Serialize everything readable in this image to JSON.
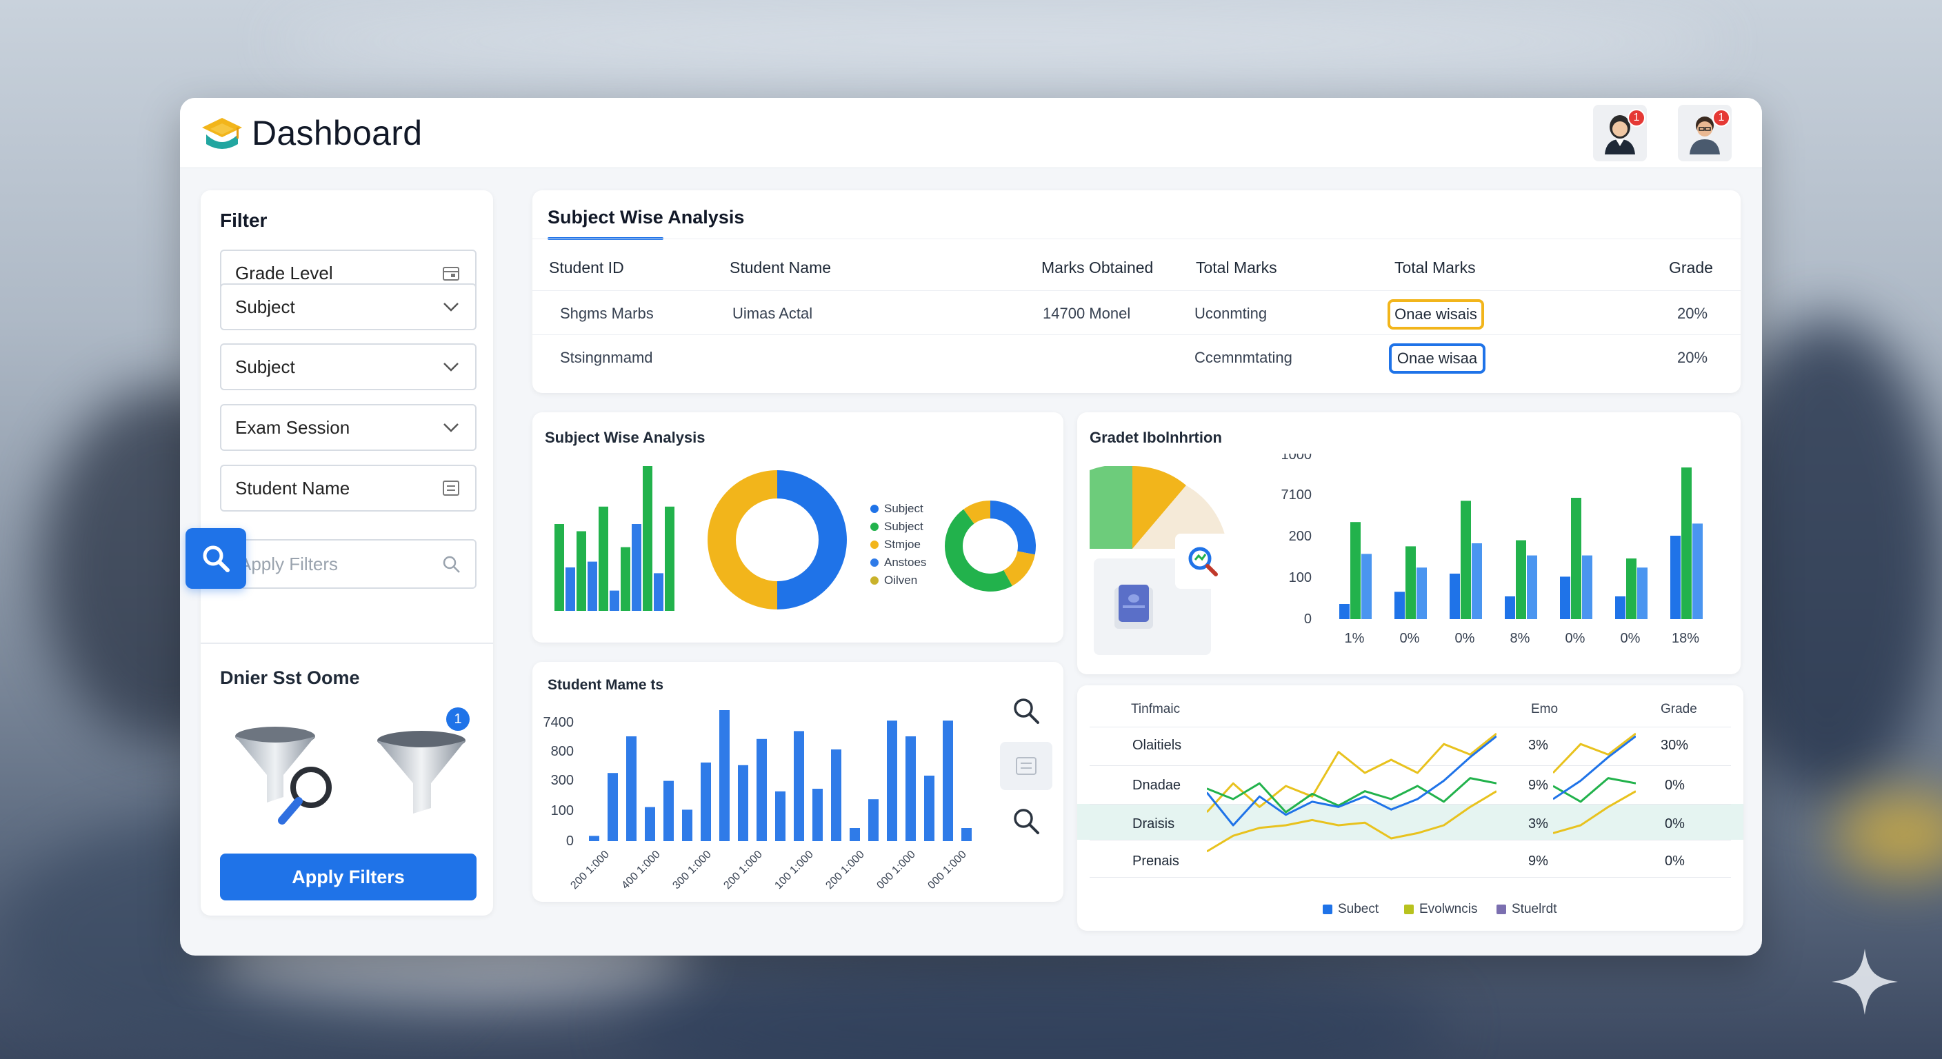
{
  "app": {
    "title": "Dashboard"
  },
  "header": {
    "avatars": [
      {
        "name": "user-avatar-1",
        "badge": "1"
      },
      {
        "name": "user-avatar-2",
        "badge": "1"
      }
    ]
  },
  "filter": {
    "title": "Filter",
    "fields": [
      {
        "label": "Grade Level",
        "icon": "calendar-icon"
      },
      {
        "label": "Subject",
        "icon": "chevron-down-icon"
      },
      {
        "label": "Subject",
        "icon": "chevron-down-icon"
      },
      {
        "label": "Exam Session",
        "icon": "chevron-down-icon"
      },
      {
        "label": "Student Name",
        "icon": "list-icon"
      }
    ],
    "search_placeholder": "Apply Filters",
    "saved_title": "Dnier Sst Oome",
    "saved_badge": "1",
    "apply_label": "Apply Filters"
  },
  "table": {
    "title": "Subject Wise Analysis",
    "headers": [
      "Student ID",
      "Student Name",
      "Marks Obtained",
      "Total Marks",
      "Total Marks",
      "Grade"
    ],
    "rows": [
      [
        "Shgms Marbs",
        "Uimas Actal",
        "14700 Monel",
        "Uconmting",
        "Onae wisais",
        "20%"
      ],
      [
        "Stsingnmamd",
        "",
        "",
        "Ccemnmtating",
        "Onae wisaa",
        "20%"
      ]
    ]
  },
  "subject_card": {
    "title": "Subject Wise Analysis",
    "legend": [
      "Subject",
      "Subject",
      "Stmjoe",
      "Anstoes",
      "Oilven"
    ]
  },
  "grade_card": {
    "title": "Gradet Ibolnhrtion"
  },
  "student_card": {
    "title": "Student Mame ts"
  },
  "trend_card": {
    "headers": [
      "Tinfmaic",
      "Emo",
      "Grade"
    ],
    "rows": [
      {
        "label": "Olaitiels",
        "mid": "3%",
        "grade": "30%"
      },
      {
        "label": "Dnadae",
        "mid": "9%",
        "grade": "0%"
      },
      {
        "label": "Draisis",
        "mid": "3%",
        "grade": "0%"
      },
      {
        "label": "Prenais",
        "mid": "9%",
        "grade": "0%"
      }
    ],
    "legend": [
      "Subect",
      "Evolwncis",
      "Stuelrdt"
    ]
  },
  "colors": {
    "accent": "#1f73e8",
    "green": "#22b24c",
    "yellow": "#f2b51b",
    "teal": "#20a0a0"
  },
  "chart_data": [
    {
      "type": "bar",
      "title": "Subject Wise Analysis",
      "series": [
        {
          "color": "#22b24c",
          "values": [
            60,
            55,
            72,
            44,
            100,
            72
          ]
        },
        {
          "color": "#2f7be8",
          "values": [
            30,
            34,
            14,
            60,
            26,
            0
          ]
        }
      ],
      "ylim": [
        0,
        100
      ]
    },
    {
      "type": "pie",
      "title": "Subject Wise Analysis",
      "slices": [
        {
          "color": "#1f73e8",
          "value": 50
        },
        {
          "color": "#f2b51b",
          "value": 50
        }
      ]
    },
    {
      "type": "pie",
      "slices": [
        {
          "color": "#1f73e8",
          "value": 28
        },
        {
          "color": "#f2b51b",
          "value": 14
        },
        {
          "color": "#22b24c",
          "value": 48
        },
        {
          "color": "#f2b51b",
          "value": 10
        }
      ]
    },
    {
      "type": "bar",
      "title": "Gradet Ibolnhrtion",
      "categories": [
        "1%",
        "0%",
        "0%",
        "8%",
        "0%",
        "0%",
        "18%"
      ],
      "y_ticks": [
        "0",
        "100",
        "200",
        "7100",
        "1000"
      ],
      "series": [
        {
          "color": "#1f73e8",
          "values": [
            10,
            18,
            30,
            15,
            28,
            15,
            55
          ]
        },
        {
          "color": "#22b24c",
          "values": [
            64,
            48,
            78,
            52,
            80,
            40,
            100
          ]
        },
        {
          "color": "#4a95f0",
          "values": [
            43,
            34,
            50,
            42,
            42,
            34,
            63
          ]
        }
      ]
    },
    {
      "type": "bar",
      "title": "Student Mame ts",
      "categories": [
        "200 1:000",
        "400 1:000",
        "300 1:000",
        "200 1:000",
        "100 1:000",
        "200 1:000",
        "000 1:000",
        "000 1:000"
      ],
      "y_ticks": [
        "0",
        "100",
        "300",
        "800",
        "7400"
      ],
      "series": [
        {
          "color": "#2f7be8",
          "values": [
            4,
            52,
            80,
            26,
            46,
            24,
            60,
            100,
            58,
            78,
            38,
            84,
            40,
            70,
            10,
            32,
            92,
            80,
            50,
            92,
            10
          ]
        }
      ],
      "ylim": [
        0,
        100
      ]
    },
    {
      "type": "line",
      "series": [
        {
          "color": "#e8c21e",
          "values": [
            40,
            62,
            44,
            60,
            52,
            86,
            70,
            80,
            70,
            92,
            84,
            100
          ]
        },
        {
          "color": "#22b24c",
          "values": [
            58,
            50,
            62,
            40,
            54,
            45,
            56,
            50,
            60,
            48,
            66,
            62
          ]
        },
        {
          "color": "#1f73e8",
          "values": [
            55,
            30,
            52,
            38,
            48,
            44,
            52,
            42,
            50,
            64,
            82,
            98
          ]
        },
        {
          "color": "#e8c21e",
          "values": [
            10,
            22,
            28,
            30,
            34,
            30,
            32,
            20,
            24,
            30,
            44,
            56
          ]
        }
      ]
    }
  ]
}
